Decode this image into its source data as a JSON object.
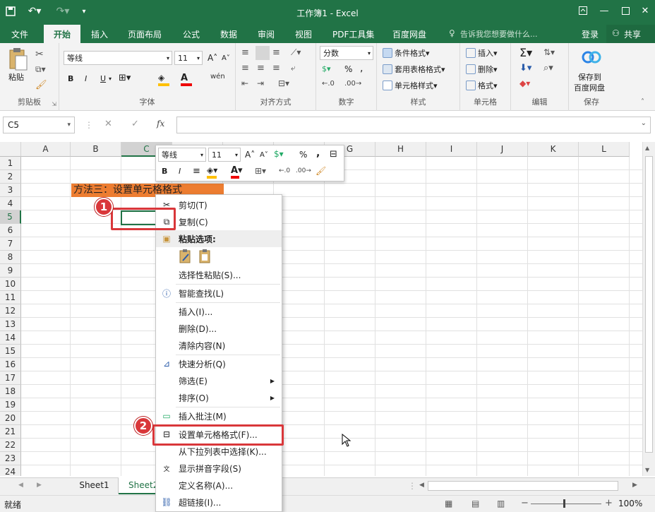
{
  "window": {
    "title": "工作簿1 - Excel"
  },
  "tabs": [
    "文件",
    "开始",
    "插入",
    "页面布局",
    "公式",
    "数据",
    "审阅",
    "视图",
    "PDF工具集",
    "百度网盘"
  ],
  "tell_me": "告诉我您想要做什么...",
  "login": "登录",
  "share": "共享",
  "ribbon": {
    "clipboard": {
      "paste": "粘贴",
      "label": "剪贴板"
    },
    "font": {
      "name": "等线",
      "size": "11",
      "bold": "B",
      "italic": "I",
      "underline": "U",
      "label": "字体"
    },
    "align": {
      "label": "对齐方式"
    },
    "number": {
      "format": "分数",
      "label": "数字"
    },
    "styles": {
      "cond": "条件格式",
      "table": "套用表格格式",
      "cell": "单元格样式",
      "label": "样式"
    },
    "cells": {
      "insert": "插入",
      "delete": "删除",
      "format": "格式",
      "label": "单元格"
    },
    "editing": {
      "label": "编辑"
    },
    "save": {
      "line1": "保存到",
      "line2": "百度网盘",
      "label": "保存"
    }
  },
  "namebox": "C5",
  "fx": "fx",
  "columns": [
    "A",
    "B",
    "C",
    "D",
    "E",
    "F",
    "G",
    "H",
    "I",
    "J",
    "K",
    "L"
  ],
  "rows": [
    "1",
    "2",
    "3",
    "4",
    "5",
    "6",
    "7",
    "8",
    "9",
    "10",
    "11",
    "12",
    "13",
    "14",
    "15",
    "16",
    "17",
    "18",
    "19",
    "20",
    "21",
    "22",
    "23",
    "24"
  ],
  "cell_b3": "方法三：设置单元格格式",
  "mini_toolbar": {
    "font": "等线",
    "size": "11",
    "bold": "B",
    "italic": "I",
    "percent": "%",
    "comma": ","
  },
  "context_menu": {
    "cut": "剪切(T)",
    "copy": "复制(C)",
    "paste_options": "粘贴选项:",
    "paste_special": "选择性粘贴(S)...",
    "smart_lookup": "智能查找(L)",
    "insert": "插入(I)...",
    "delete": "删除(D)...",
    "clear": "清除内容(N)",
    "quick_analysis": "快速分析(Q)",
    "filter": "筛选(E)",
    "sort": "排序(O)",
    "insert_comment": "插入批注(M)",
    "format_cells": "设置单元格格式(F)...",
    "pick_list": "从下拉列表中选择(K)...",
    "phonetic": "显示拼音字段(S)",
    "define_name": "定义名称(A)...",
    "hyperlink": "超链接(I)..."
  },
  "sheets": [
    "Sheet1",
    "Sheet2"
  ],
  "status": {
    "ready": "就绪",
    "zoom": "100%"
  },
  "badges": [
    "1",
    "2"
  ],
  "colors": {
    "excel_green": "#217346",
    "highlight": "#ed7d31",
    "callout": "#d9373a"
  }
}
